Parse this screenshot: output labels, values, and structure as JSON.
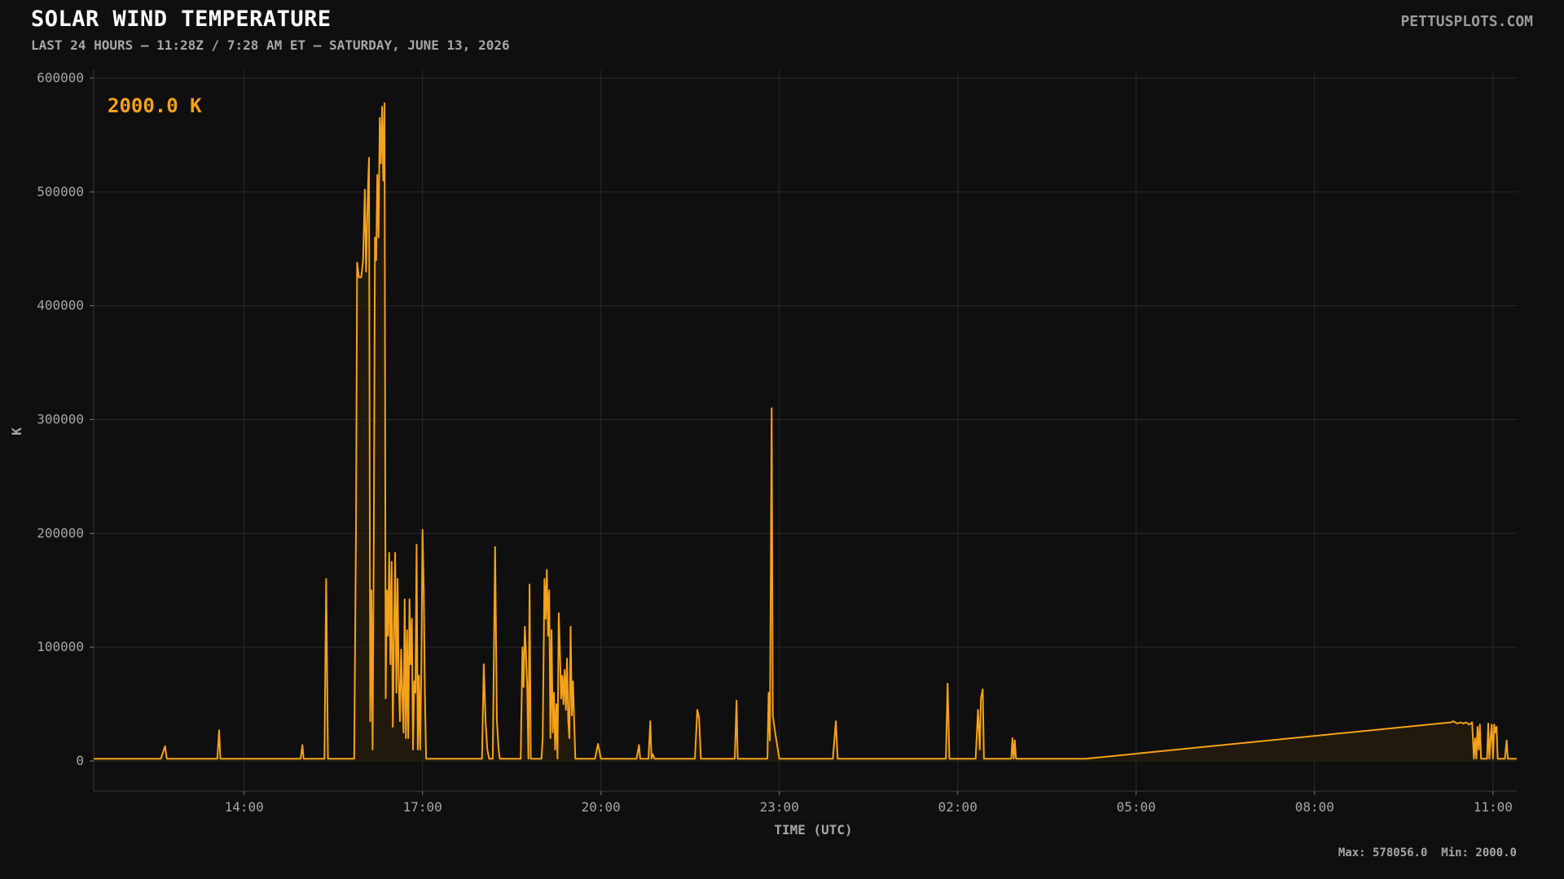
{
  "header": {
    "title": "SOLAR WIND TEMPERATURE",
    "subtitle": "LAST 24 HOURS — 11:28Z / 7:28 AM ET — SATURDAY, JUNE 13, 2026",
    "brand": "PETTUSPLOTS.COM"
  },
  "current_value": "2000.0 K",
  "footer": {
    "stats": "Max: 578056.0  Min: 2000.0"
  },
  "colors": {
    "background": "#0f0f0f",
    "line": "#f5a21b",
    "fill": "#2a1e0a",
    "grid": "#2a2a2a"
  },
  "chart_data": {
    "type": "line",
    "title": "SOLAR WIND TEMPERATURE",
    "xlabel": "TIME (UTC)",
    "ylabel": "K",
    "ylim": [
      0,
      600000
    ],
    "yticks": [
      0,
      100000,
      200000,
      300000,
      400000,
      500000,
      600000
    ],
    "xticks": [
      "14:00",
      "17:00",
      "20:00",
      "23:00",
      "02:00",
      "05:00",
      "08:00",
      "11:00"
    ],
    "xtick_hours": [
      14,
      17,
      20,
      23,
      26,
      29,
      32,
      35
    ],
    "xlim_hours": [
      11.47,
      35.4
    ],
    "grid": true,
    "x_unit": "hours UTC (values above 24 are the next day)",
    "series": [
      {
        "values": [
          [
            11.47,
            2000
          ],
          [
            12.6,
            2000
          ],
          [
            12.67,
            13000
          ],
          [
            12.7,
            2000
          ],
          [
            13.55,
            2000
          ],
          [
            13.58,
            27000
          ],
          [
            13.6,
            2000
          ],
          [
            14.95,
            2000
          ],
          [
            14.98,
            14000
          ],
          [
            15.0,
            2000
          ],
          [
            15.35,
            2000
          ],
          [
            15.38,
            160000
          ],
          [
            15.41,
            2000
          ],
          [
            15.85,
            2000
          ],
          [
            15.88,
            200000
          ],
          [
            15.9,
            438000
          ],
          [
            15.93,
            425000
          ],
          [
            15.97,
            425000
          ],
          [
            16.0,
            440000
          ],
          [
            16.03,
            502000
          ],
          [
            16.05,
            430000
          ],
          [
            16.08,
            500000
          ],
          [
            16.1,
            530000
          ],
          [
            16.12,
            35000
          ],
          [
            16.14,
            150000
          ],
          [
            16.16,
            10000
          ],
          [
            16.18,
            200000
          ],
          [
            16.2,
            460000
          ],
          [
            16.22,
            440000
          ],
          [
            16.24,
            515000
          ],
          [
            16.26,
            460000
          ],
          [
            16.28,
            565000
          ],
          [
            16.3,
            525000
          ],
          [
            16.32,
            575000
          ],
          [
            16.34,
            510000
          ],
          [
            16.36,
            578056
          ],
          [
            16.38,
            55000
          ],
          [
            16.4,
            150000
          ],
          [
            16.42,
            110000
          ],
          [
            16.44,
            183000
          ],
          [
            16.46,
            85000
          ],
          [
            16.48,
            175000
          ],
          [
            16.5,
            30000
          ],
          [
            16.52,
            110000
          ],
          [
            16.54,
            183000
          ],
          [
            16.56,
            60000
          ],
          [
            16.58,
            160000
          ],
          [
            16.6,
            70000
          ],
          [
            16.62,
            35000
          ],
          [
            16.64,
            98000
          ],
          [
            16.66,
            60000
          ],
          [
            16.68,
            25000
          ],
          [
            16.7,
            142000
          ],
          [
            16.72,
            20000
          ],
          [
            16.74,
            115000
          ],
          [
            16.76,
            20000
          ],
          [
            16.78,
            142000
          ],
          [
            16.8,
            85000
          ],
          [
            16.82,
            125000
          ],
          [
            16.84,
            10000
          ],
          [
            16.86,
            70000
          ],
          [
            16.88,
            60000
          ],
          [
            16.9,
            190000
          ],
          [
            16.92,
            10000
          ],
          [
            16.94,
            75000
          ],
          [
            16.96,
            10000
          ],
          [
            16.98,
            85000
          ],
          [
            17.0,
            203000
          ],
          [
            17.02,
            150000
          ],
          [
            17.04,
            60000
          ],
          [
            17.06,
            2000
          ],
          [
            18.0,
            2000
          ],
          [
            18.03,
            85000
          ],
          [
            18.06,
            35000
          ],
          [
            18.09,
            10000
          ],
          [
            18.12,
            2000
          ],
          [
            18.18,
            2000
          ],
          [
            18.22,
            188000
          ],
          [
            18.25,
            35000
          ],
          [
            18.28,
            10000
          ],
          [
            18.3,
            2000
          ],
          [
            18.65,
            2000
          ],
          [
            18.68,
            100000
          ],
          [
            18.7,
            65000
          ],
          [
            18.72,
            118000
          ],
          [
            18.74,
            95000
          ],
          [
            18.76,
            65000
          ],
          [
            18.78,
            2000
          ],
          [
            18.8,
            155000
          ],
          [
            18.82,
            2000
          ],
          [
            19.0,
            2000
          ],
          [
            19.02,
            20000
          ],
          [
            19.05,
            160000
          ],
          [
            19.07,
            125000
          ],
          [
            19.09,
            168000
          ],
          [
            19.11,
            110000
          ],
          [
            19.13,
            150000
          ],
          [
            19.15,
            20000
          ],
          [
            19.17,
            115000
          ],
          [
            19.19,
            25000
          ],
          [
            19.21,
            60000
          ],
          [
            19.23,
            10000
          ],
          [
            19.25,
            50000
          ],
          [
            19.27,
            2000
          ],
          [
            19.29,
            130000
          ],
          [
            19.31,
            95000
          ],
          [
            19.33,
            55000
          ],
          [
            19.35,
            75000
          ],
          [
            19.37,
            50000
          ],
          [
            19.39,
            80000
          ],
          [
            19.41,
            45000
          ],
          [
            19.43,
            90000
          ],
          [
            19.45,
            35000
          ],
          [
            19.47,
            20000
          ],
          [
            19.49,
            118000
          ],
          [
            19.51,
            40000
          ],
          [
            19.53,
            70000
          ],
          [
            19.55,
            35000
          ],
          [
            19.57,
            2000
          ],
          [
            19.9,
            2000
          ],
          [
            19.95,
            15000
          ],
          [
            20.0,
            2000
          ],
          [
            20.6,
            2000
          ],
          [
            20.64,
            14000
          ],
          [
            20.66,
            2000
          ],
          [
            20.8,
            2000
          ],
          [
            20.83,
            35000
          ],
          [
            20.85,
            2000
          ],
          [
            20.87,
            6000
          ],
          [
            20.9,
            2000
          ],
          [
            21.58,
            2000
          ],
          [
            21.62,
            45000
          ],
          [
            21.65,
            38000
          ],
          [
            21.68,
            2000
          ],
          [
            22.25,
            2000
          ],
          [
            22.28,
            53000
          ],
          [
            22.3,
            2000
          ],
          [
            22.8,
            2000
          ],
          [
            22.82,
            60000
          ],
          [
            22.84,
            18000
          ],
          [
            22.87,
            310000
          ],
          [
            22.89,
            40000
          ],
          [
            22.93,
            25000
          ],
          [
            23.0,
            2000
          ],
          [
            23.9,
            2000
          ],
          [
            23.95,
            35000
          ],
          [
            23.98,
            2000
          ],
          [
            25.8,
            2000
          ],
          [
            25.83,
            68000
          ],
          [
            25.86,
            2000
          ],
          [
            26.3,
            2000
          ],
          [
            26.34,
            45000
          ],
          [
            26.37,
            10000
          ],
          [
            26.39,
            55000
          ],
          [
            26.42,
            63000
          ],
          [
            26.44,
            2000
          ],
          [
            26.9,
            2000
          ],
          [
            26.92,
            20000
          ],
          [
            26.94,
            2000
          ],
          [
            26.96,
            18000
          ],
          [
            26.98,
            2000
          ],
          [
            28.15,
            2000
          ],
          [
            34.3,
            34000
          ],
          [
            34.33,
            35000
          ],
          [
            34.4,
            33000
          ],
          [
            34.45,
            34000
          ],
          [
            34.5,
            33000
          ],
          [
            34.55,
            34000
          ],
          [
            34.6,
            32000
          ],
          [
            34.65,
            34000
          ],
          [
            34.68,
            2000
          ],
          [
            34.7,
            20000
          ],
          [
            34.72,
            2000
          ],
          [
            34.74,
            30000
          ],
          [
            34.76,
            10000
          ],
          [
            34.78,
            32000
          ],
          [
            34.8,
            2000
          ],
          [
            34.9,
            2000
          ],
          [
            34.92,
            33000
          ],
          [
            34.94,
            2000
          ],
          [
            34.96,
            20000
          ],
          [
            34.98,
            32000
          ],
          [
            35.0,
            2000
          ],
          [
            35.02,
            32000
          ],
          [
            35.04,
            25000
          ],
          [
            35.06,
            30000
          ],
          [
            35.08,
            2000
          ],
          [
            35.2,
            2000
          ],
          [
            35.23,
            18000
          ],
          [
            35.25,
            2000
          ],
          [
            35.4,
            2000
          ]
        ]
      }
    ]
  }
}
